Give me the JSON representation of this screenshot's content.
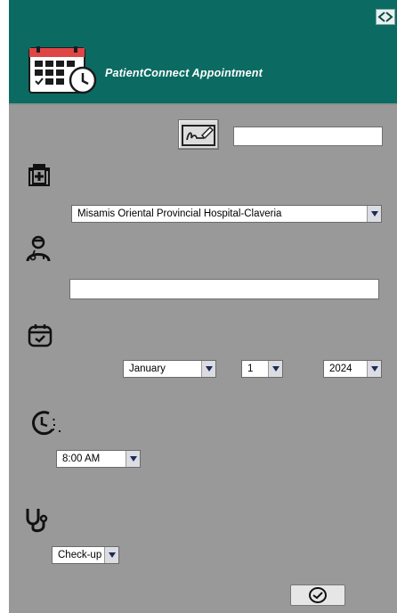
{
  "header": {
    "title": "PatientConnect Appointment",
    "back_icon": "swap-arrows-icon",
    "logo_icon": "calendar-clock-icon"
  },
  "form": {
    "signature_icon": "signature-icon",
    "patient_name_value": "",
    "hospital_icon": "hospital-icon",
    "hospital_selected": "Misamis Oriental Provincial Hospital-Claveria",
    "doctor_icon": "doctor-icon",
    "doctor_value": "",
    "date_icon": "calendar-check-icon",
    "month_selected": "January",
    "day_selected": "1",
    "year_selected": "2024",
    "time_icon": "clock-icon",
    "time_selected": "8:00 AM",
    "service_icon": "stethoscope-icon",
    "service_selected": "Check-up",
    "submit_icon": "check-circle-icon"
  },
  "colors": {
    "header_bg": "#0b6b62",
    "content_bg": "#999999"
  }
}
